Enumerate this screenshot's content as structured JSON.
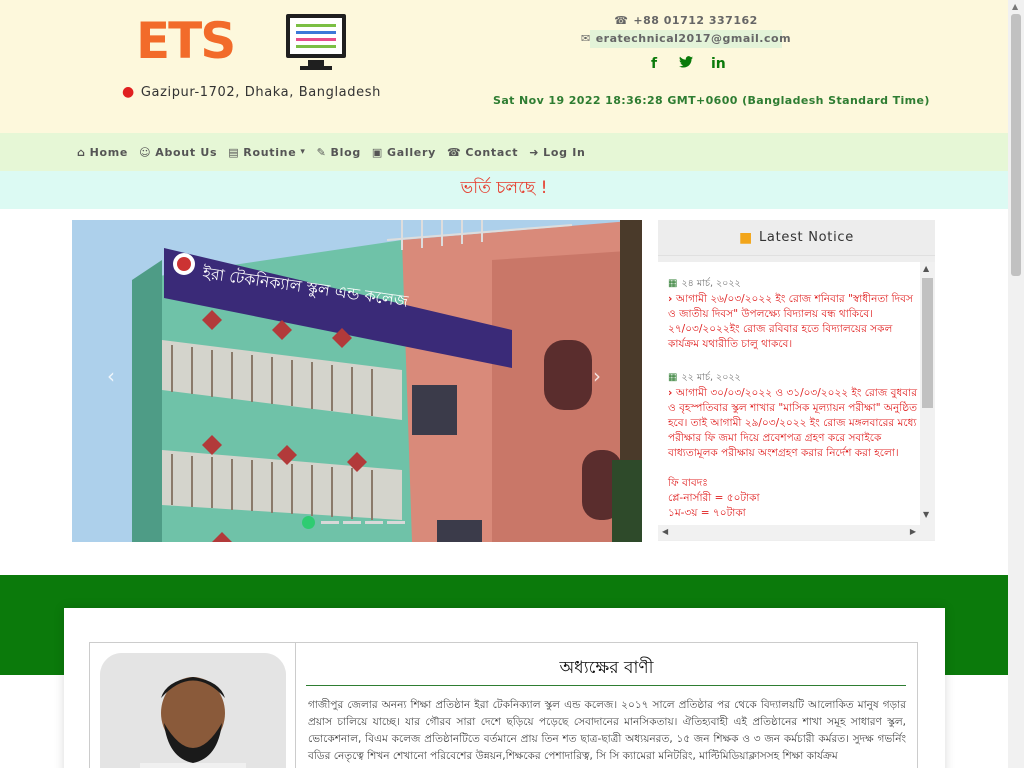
{
  "header": {
    "logo_text": "ETS",
    "location": "Gazipur-1702, Dhaka, Bangladesh",
    "phone": "+88 01712 337162",
    "email": "eratechnical2017@gmail.com",
    "social": {
      "facebook": "f",
      "twitter": "t",
      "linkedin": "in"
    },
    "datetime": "Sat Nov 19 2022 18:36:28 GMT+0600 (Bangladesh Standard Time)"
  },
  "nav": {
    "items": [
      {
        "label": "Home",
        "icon": "home-icon",
        "glyph": "⌂"
      },
      {
        "label": "About Us",
        "icon": "user-icon",
        "glyph": "☺"
      },
      {
        "label": "Routine",
        "icon": "book-icon",
        "glyph": "▤",
        "dropdown": "▾"
      },
      {
        "label": "Blog",
        "icon": "edit-icon",
        "glyph": "✎"
      },
      {
        "label": "Gallery",
        "icon": "image-icon",
        "glyph": "▣"
      },
      {
        "label": "Contact",
        "icon": "contact-icon",
        "glyph": "☎"
      },
      {
        "label": "Log In",
        "icon": "login-icon",
        "glyph": "➜"
      }
    ]
  },
  "marquee": {
    "text": "ভর্তি চলছে !"
  },
  "slider": {
    "sign_text": "ইরা টেকনিক্যাল স্কুল এন্ড কলেজ",
    "prev": "‹",
    "next": "›",
    "slides_count": 5,
    "active_index": 0
  },
  "notice": {
    "title": "Latest Notice",
    "entries": [
      {
        "date": "২৪ মার্চ, ২০২২",
        "text": "আগামী ২৬/০৩/২০২২ ইং রোজ শনিবার \"স্বাধীনতা দিবস ও জাতীয় দিবস\" উপলক্ষ্যে বিদ্যালয় বন্ধ থাকিবে। ২৭/০৩/২০২২ইং রোজ রবিবার হতে বিদ্যালয়ের সকল কার্যক্রম যথারীতি চালু থাকবে।"
      },
      {
        "date": "২২ মার্চ, ২০২২",
        "text": "আগামী ৩০/০৩/২০২২ ও ৩১/০৩/২০২২ ইং রোজ বুধবার ও বৃহস্পতিবার স্কুল শাখার \"মাসিক মূল্যায়ন পরীক্ষা\" অনুষ্ঠিত হবে। তাই আগামী ২৯/০৩/২০২২ ইং রোজ মঙ্গলবারের মধ্যে পরীক্ষার ফি জমা দিয়ে প্রবেশপত্র গ্রহণ করে সবাইকে বাধ্যতামূলক পরীক্ষায় অংশগ্রহণ করার নির্দেশ করা হলো।",
        "extra": [
          "ফি বাবদঃ",
          "প্লে-নার্সারী = ৫০টাকা",
          "১ম-৩য় = ৭০টাকা"
        ]
      }
    ]
  },
  "message": {
    "title": "অধ্যক্ষের বাণী",
    "body": "গাজীপুর জেলার অনন্য শিক্ষা প্রতিষ্ঠান ইরা টেকনিক্যাল স্কুল এন্ড কলেজ। ২০১৭ সালে প্রতিষ্ঠার পর থেকে বিদ্যালয়টি আলোকিত মানুষ গড়ার প্রয়াস চালিয়ে যাচ্ছে। যার গৌরব সারা দেশে ছড়িয়ে পড়েছে সেবাদানের মানসিকতায়। ঐতিহ্যবাহী এই প্রতিষ্ঠানের শাখা সমূহ সাধারণ স্কুল, ভোকেশনাল, বিএম কলেজ প্রতিষ্ঠানটিতে বর্তমানে প্রায় তিন শত ছাত্র-ছাত্রী অধ্যয়নরত, ১৫ জন শিক্ষক ও ৩ জন কর্মচারী কর্মরত। সুদক্ষ গভর্নিং বডির নেতৃত্বে শিখন শেখানো পরিবেশের উন্নয়ন,শিক্ষকের পেশাদারিত্ব, সি সি ক্যামেরা মনিটরিং, মাল্টিমিডিয়াক্লাসসহ শিক্ষা কার্যক্রম"
  },
  "colors": {
    "header_bg": "#fdf8dc",
    "nav_bg": "#e6f7d6",
    "marquee_bg": "#dcfaf3",
    "brand_orange": "#f26b2a",
    "accent_green": "#0b7a0b",
    "notice_red": "#e02020"
  }
}
